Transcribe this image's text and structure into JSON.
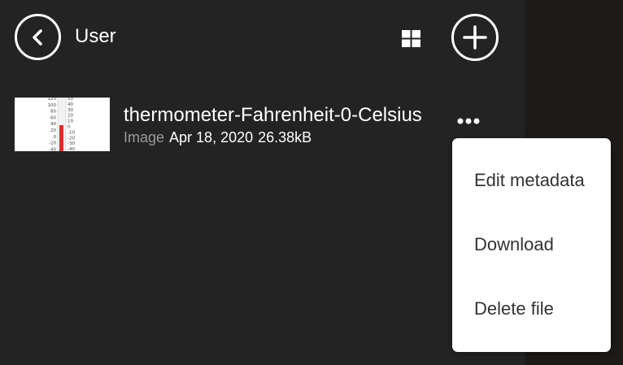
{
  "header": {
    "title": "User",
    "back_icon": "chevron-left-icon",
    "view_icon": "grid-view-icon",
    "add_icon": "plus-icon"
  },
  "file": {
    "name": "thermometer-Fahrenheit-0-Celsius",
    "type": "Image",
    "date": "Apr 18, 2020",
    "size": "26.38kB",
    "more_icon": "more-horizontal-icon",
    "thumbnail": {
      "left_scale": [
        "120",
        "100",
        "80",
        "60",
        "40",
        "20",
        "0",
        "-20",
        "-40"
      ],
      "right_scale": [
        "50",
        "40",
        "30",
        "20",
        "10",
        "0",
        "-10",
        "-20",
        "-30",
        "-40"
      ]
    }
  },
  "menu": {
    "items": [
      "Edit metadata",
      "Download",
      "Delete file"
    ]
  },
  "colors": {
    "panel": "#232323",
    "backdrop": "#1d1b19",
    "secondary_text": "#9a9a9a",
    "menu_text": "#333333",
    "mercury": "#d9302b"
  }
}
